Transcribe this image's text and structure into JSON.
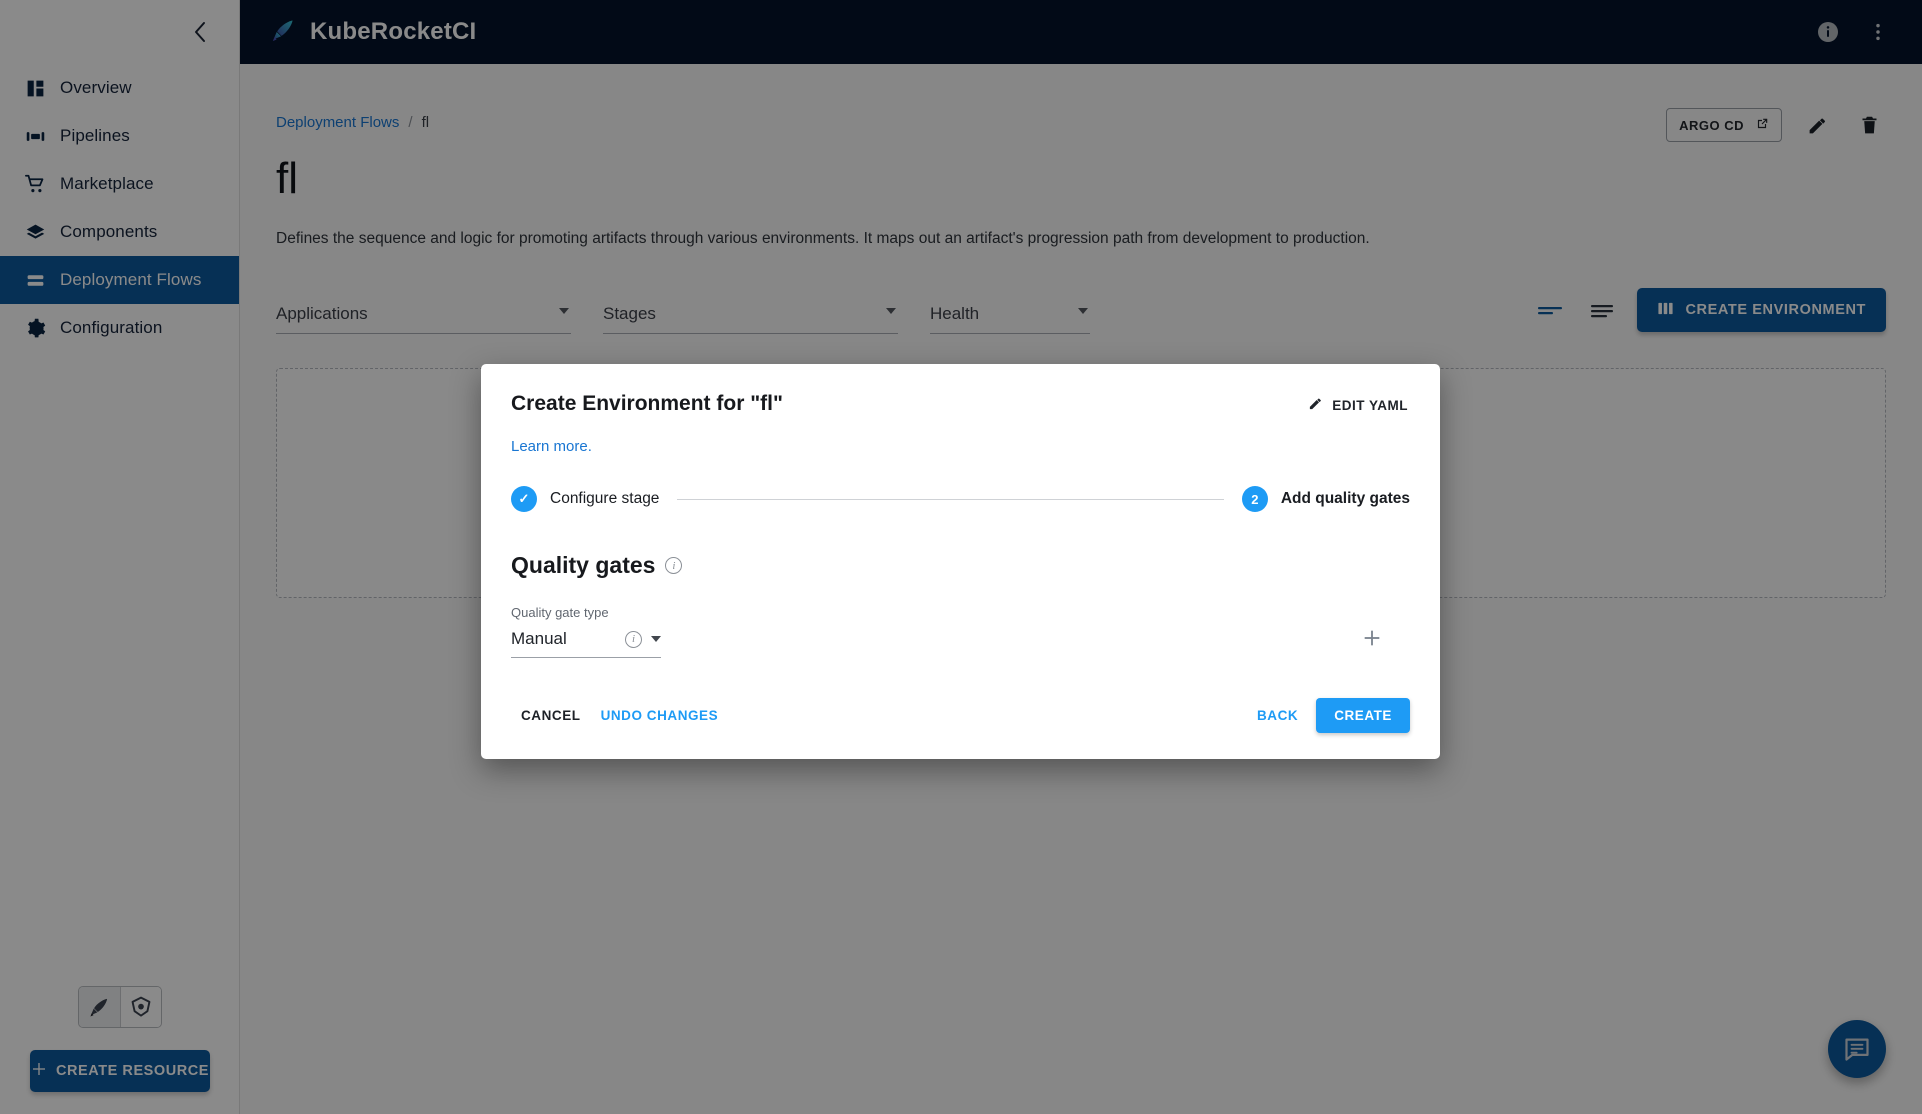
{
  "appbar": {
    "brand_name": "KubeRocketCI",
    "logo_icon": "rocket-feather-icon",
    "info_icon": "info-circle-icon",
    "overflow_icon": "more-vertical-icon"
  },
  "sidebar": {
    "collapse_icon": "chevron-left-icon",
    "items": [
      {
        "label": "Overview",
        "icon": "dashboard-grid-icon",
        "active": false
      },
      {
        "label": "Pipelines",
        "icon": "pipelines-icon",
        "active": false
      },
      {
        "label": "Marketplace",
        "icon": "shopping-cart-icon",
        "active": false
      },
      {
        "label": "Components",
        "icon": "layers-icon",
        "active": false
      },
      {
        "label": "Deployment Flows",
        "icon": "stacked-bars-icon",
        "active": true
      },
      {
        "label": "Configuration",
        "icon": "gear-icon",
        "active": false
      }
    ],
    "mode_toggle": [
      {
        "icon": "rocket-feather-icon",
        "selected": true
      },
      {
        "icon": "kubernetes-icon",
        "selected": false
      }
    ],
    "create_resource_label": "CREATE RESOURCE",
    "create_resource_icon": "plus-icon"
  },
  "page": {
    "breadcrumb": {
      "parent": "Deployment Flows",
      "separator": "/",
      "current": "fl"
    },
    "title": "fl",
    "description": "Defines the sequence and logic for promoting artifacts through various environments. It maps out an artifact's progression path from development to production.",
    "header_actions": {
      "argo_cd_label": "ARGO CD",
      "argo_cd_icon": "external-link-icon",
      "edit_icon": "pencil-icon",
      "delete_icon": "trash-icon"
    },
    "filters": [
      {
        "label": "Applications",
        "name": "applications"
      },
      {
        "label": "Stages",
        "name": "stages"
      },
      {
        "label": "Health",
        "name": "health"
      }
    ],
    "view_toggles": [
      {
        "icon": "compact-list-icon",
        "active": true
      },
      {
        "icon": "detailed-list-icon",
        "active": false
      }
    ],
    "create_environment_label": "CREATE ENVIRONMENT",
    "create_environment_icon": "columns-icon",
    "chat_fab_icon": "chat-bubble-icon"
  },
  "modal": {
    "title": "Create Environment for \"fl\"",
    "edit_yaml_label": "EDIT YAML",
    "edit_yaml_icon": "pencil-icon",
    "learn_more_label": "Learn more.",
    "steps": [
      {
        "label": "Configure stage",
        "marker": "✓",
        "state": "complete"
      },
      {
        "label": "Add quality gates",
        "marker": "2",
        "state": "current"
      }
    ],
    "section": {
      "title": "Quality gates",
      "title_info_icon": "info-circle-icon",
      "field_label": "Quality gate type",
      "field_value": "Manual",
      "field_info_icon": "info-circle-icon",
      "field_caret_icon": "chevron-down-icon",
      "add_icon": "plus-icon"
    },
    "actions": {
      "cancel_label": "CANCEL",
      "undo_label": "UNDO CHANGES",
      "back_label": "BACK",
      "create_label": "CREATE"
    }
  },
  "colors": {
    "appbar_bg": "#04142c",
    "brand_blue": "#0c5a9e",
    "accent_blue": "#1e9bf5",
    "link_blue": "#1976d2"
  }
}
